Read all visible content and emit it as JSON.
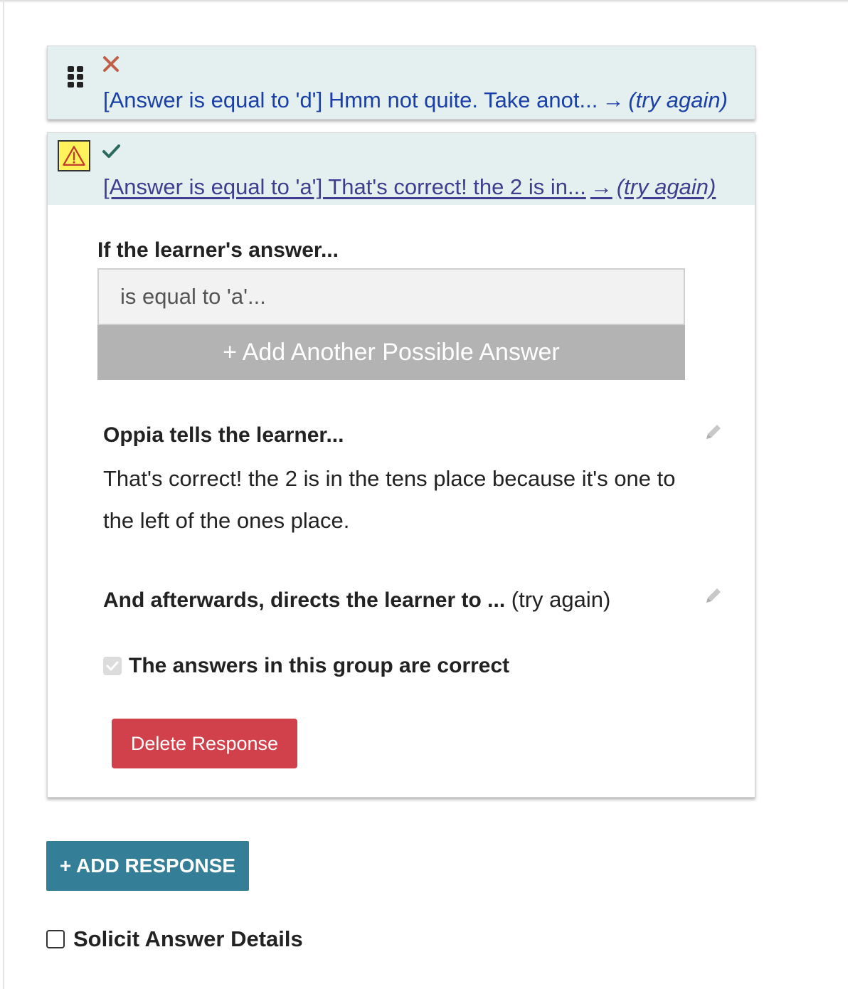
{
  "responses": [
    {
      "status": "incorrect",
      "summary": "[Answer is equal to 'd'] Hmm not quite. Take anot...",
      "arrow": "→",
      "destination": "(try again)"
    },
    {
      "status": "correct",
      "warning": true,
      "summary": "[Answer is equal to 'a'] That's correct! the 2 is in...",
      "arrow": "→",
      "destination": "(try again)",
      "editor": {
        "rule_heading": "If the learner's answer...",
        "rule_value": "is equal to 'a'...",
        "add_answer_label": "+ Add Another Possible Answer",
        "feedback_heading": "Oppia tells the learner...",
        "feedback_text": "That's correct! the 2 is in the tens place because it's one to the left of the ones place.",
        "destination_heading": "And afterwards, directs the learner to ...",
        "destination_value": "(try again)",
        "correct_label": "The answers in this group are correct",
        "correct_checked": true,
        "delete_label": "Delete Response"
      }
    }
  ],
  "add_response_label": "+ ADD RESPONSE",
  "solicit_label": "Solicit Answer Details",
  "solicit_checked": false,
  "colors": {
    "header_bg": "#e3f0ef",
    "link_blue": "#1a3fa8",
    "incorrect_icon": "#c0604a",
    "correct_icon": "#2a6a5c",
    "delete_button": "#d0414b",
    "add_response_button": "#357e97",
    "add_answer_button": "#b3b3b3",
    "warning_yellow": "#fff25a"
  },
  "icons": [
    "drag-handle-icon",
    "incorrect-x-icon",
    "warning-icon",
    "correct-check-icon",
    "pencil-icon"
  ]
}
